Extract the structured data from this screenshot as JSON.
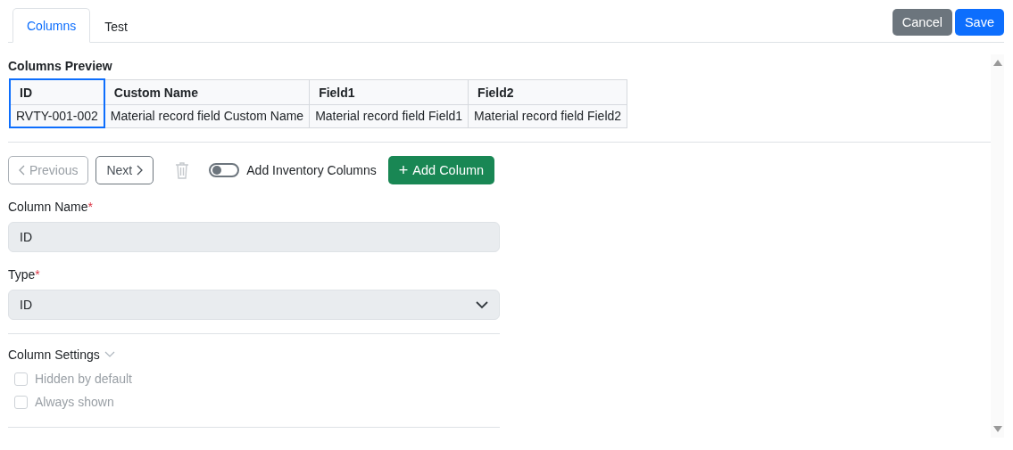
{
  "tabs": [
    {
      "label": "Columns",
      "selected": true
    },
    {
      "label": "Test",
      "selected": false
    }
  ],
  "actions": [
    {
      "label": "Cancel",
      "kind": "secondary"
    },
    {
      "label": "Save",
      "kind": "primary"
    }
  ],
  "preview": {
    "title": "Columns Preview",
    "columns": [
      {
        "header": "ID",
        "cell": "RVTY-001-002",
        "selected": true
      },
      {
        "header": "Custom Name",
        "cell": "Material record field Custom Name",
        "selected": false
      },
      {
        "header": "Field1",
        "cell": "Material record field Field1",
        "selected": false
      },
      {
        "header": "Field2",
        "cell": "Material record field Field2",
        "selected": false
      }
    ]
  },
  "toolbar": {
    "previous": {
      "label": "Previous",
      "disabled": true
    },
    "next": {
      "label": "Next",
      "disabled": false
    },
    "delete": {
      "disabled": true
    },
    "toggle": {
      "label": "Add Inventory Columns",
      "on": false
    },
    "add": {
      "label": "Add Column",
      "icon": "+"
    }
  },
  "fields": [
    {
      "kind": "text",
      "label": "Column Name",
      "required_mark": "*",
      "value": "ID"
    },
    {
      "kind": "select",
      "label": "Type",
      "required_mark": "*",
      "value": "ID"
    }
  ],
  "settings": {
    "title": "Column Settings",
    "expanded": true,
    "options": [
      {
        "label": "Hidden by default",
        "checked": false,
        "disabled": true
      },
      {
        "label": "Always shown",
        "checked": false,
        "disabled": true
      }
    ]
  }
}
